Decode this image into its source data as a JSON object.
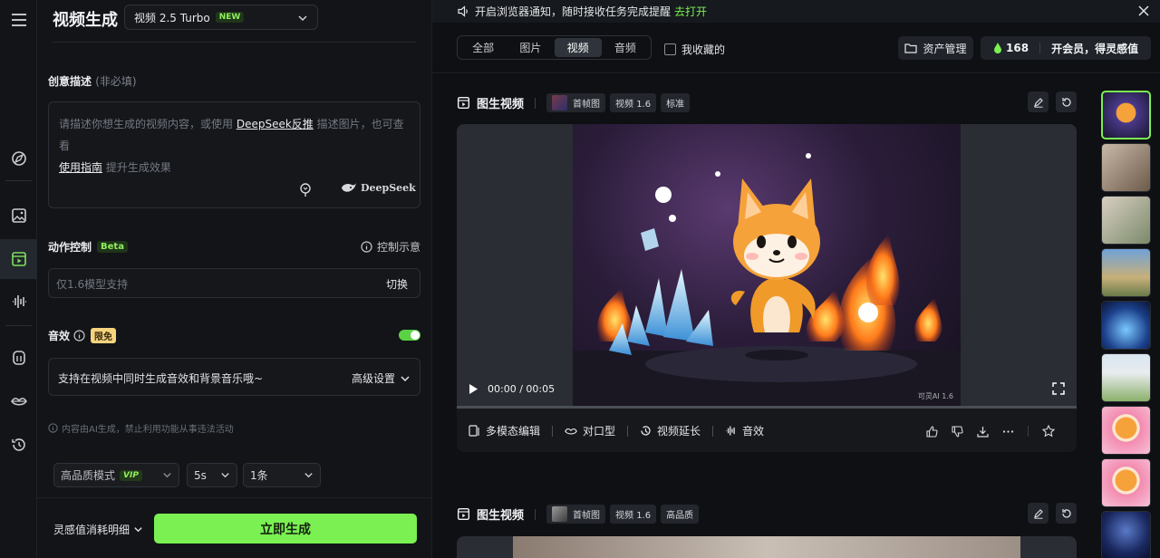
{
  "panel": {
    "title": "视频生成",
    "model": "视频 2.5 Turbo",
    "model_badge": "NEW"
  },
  "prompt": {
    "label": "创意描述",
    "label_hint": "(非必填)",
    "placeholder_a": "请描述你想生成的视频内容，或使用 ",
    "link_deepseek": "DeepSeek反推",
    "placeholder_b": " 描述图片，也可查看",
    "link_guide": "使用指南",
    "placeholder_c": " 提升生成效果",
    "deepseek": "DeepSeek"
  },
  "motion": {
    "label": "动作控制",
    "badge": "Beta",
    "demo": "控制示意",
    "placeholder": "仅1.6模型支持",
    "switch": "切换"
  },
  "sound": {
    "label": "音效",
    "badge": "限免",
    "toggle_on": true,
    "desc": "支持在视频中同时生成音效和背景音乐哦~",
    "advanced": "高级设置"
  },
  "disclaimer": "内容由AI生成，禁止利用功能从事违法活动",
  "options": {
    "mode": "高品质模式",
    "mode_badge": "VIP",
    "duration": "5s",
    "count": "1条"
  },
  "footer": {
    "cost_detail": "灵感值消耗明细",
    "generate": "立即生成"
  },
  "notification": {
    "text": "开启浏览器通知，随时接收任务完成提醒",
    "action": "去打开"
  },
  "filters": {
    "tabs": [
      "全部",
      "图片",
      "视频",
      "音频"
    ],
    "active": 2,
    "favorites": "我收藏的"
  },
  "header": {
    "assets": "资产管理",
    "credits": "168",
    "membership": "开会员，得灵感值"
  },
  "cards": [
    {
      "title": "图生视频",
      "tags": [
        "首帧图",
        "视频 1.6",
        "标准"
      ],
      "time": "00:00 / 00:05",
      "watermark": "可灵AI 1.6",
      "actions": [
        "多模态编辑",
        "对口型",
        "视频延长",
        "音效"
      ]
    },
    {
      "title": "图生视频",
      "tags": [
        "首帧图",
        "视频 1.6",
        "高品质"
      ]
    }
  ],
  "colors": {
    "accent": "#7af052",
    "background": "#0e1013",
    "panel": "#121418"
  }
}
